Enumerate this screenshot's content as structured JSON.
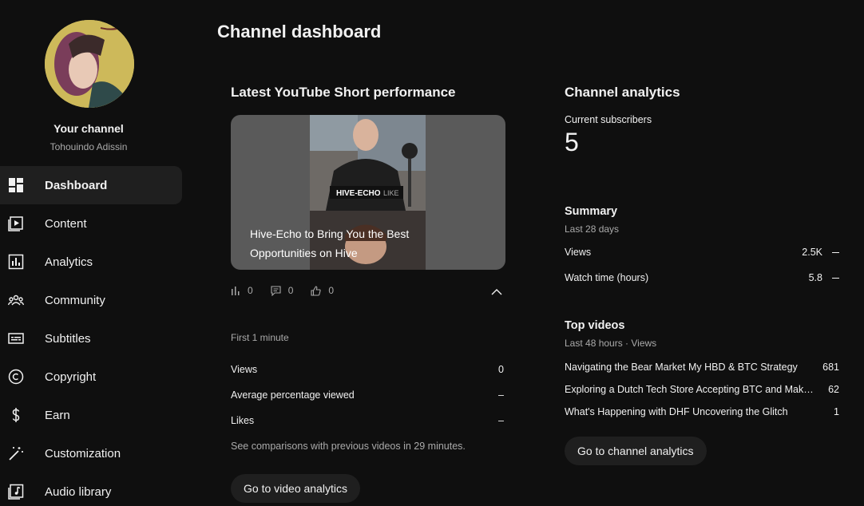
{
  "page_title": "Channel dashboard",
  "channel": {
    "name": "Your channel",
    "handle": "Tohouindo Adissin"
  },
  "nav": [
    {
      "label": "Dashboard",
      "icon": "dashboard-icon",
      "active": true
    },
    {
      "label": "Content",
      "icon": "content-icon"
    },
    {
      "label": "Analytics",
      "icon": "analytics-icon"
    },
    {
      "label": "Community",
      "icon": "community-icon"
    },
    {
      "label": "Subtitles",
      "icon": "subtitles-icon"
    },
    {
      "label": "Copyright",
      "icon": "copyright-icon"
    },
    {
      "label": "Earn",
      "icon": "dollar-icon"
    },
    {
      "label": "Customization",
      "icon": "magic-wand-icon"
    },
    {
      "label": "Audio library",
      "icon": "audio-library-icon"
    }
  ],
  "short": {
    "section_title": "Latest YouTube Short performance",
    "video_title": "Hive-Echo to Bring You the Best Opportunities on Hive",
    "thumb_banner": "HIVE-ECHO",
    "thumb_banner_suffix": "LIKE",
    "views_count": "0",
    "comments_count": "0",
    "likes_count": "0",
    "period_label": "First 1 minute",
    "metrics": [
      {
        "label": "Views",
        "value": "0"
      },
      {
        "label": "Average percentage viewed",
        "value": "–"
      },
      {
        "label": "Likes",
        "value": "–"
      }
    ],
    "comparison_note": "See comparisons with previous videos in 29 minutes.",
    "button_label": "Go to video analytics"
  },
  "analytics": {
    "section_title": "Channel analytics",
    "subscribers_label": "Current subscribers",
    "subscribers_value": "5",
    "summary_title": "Summary",
    "summary_period": "Last 28 days",
    "summary": [
      {
        "label": "Views",
        "value": "2.5K"
      },
      {
        "label": "Watch time (hours)",
        "value": "5.8"
      }
    ],
    "top_videos_title": "Top videos",
    "top_videos_period": "Last 48 hours · Views",
    "top_videos": [
      {
        "title": "Navigating the Bear Market My HBD & BTC Strategy",
        "views": "681"
      },
      {
        "title": "Exploring a Dutch Tech Store Accepting BTC and Making Crypto Mainstream",
        "views": "62"
      },
      {
        "title": "What's Happening with DHF Uncovering the Glitch",
        "views": "1"
      }
    ],
    "button_label": "Go to channel analytics"
  },
  "colors": {
    "background": "#0f0f0f",
    "active_nav": "#1f1f1f",
    "secondary_text": "#aaaaaa",
    "button_bg": "#1f1f1f"
  }
}
